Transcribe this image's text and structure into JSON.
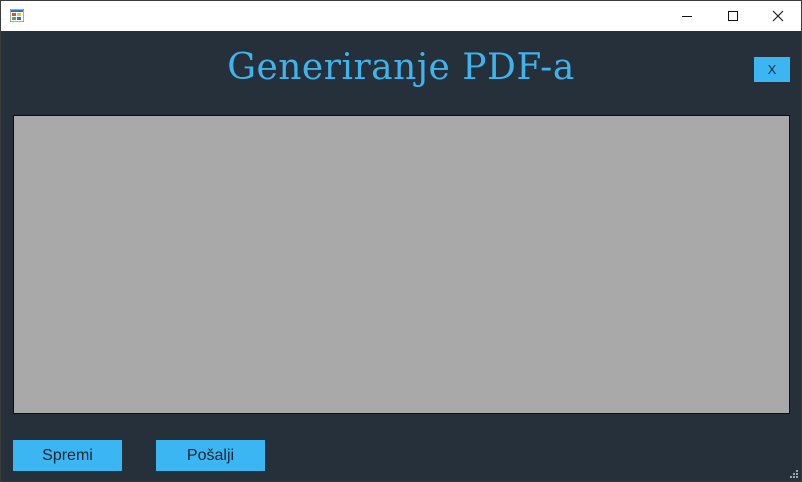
{
  "window": {
    "app_icon": "winforms-app-icon",
    "controls": {
      "minimize_icon": "minimize-icon",
      "maximize_icon": "maximize-icon",
      "close_icon": "close-icon"
    }
  },
  "form": {
    "title": "Generiranje PDF-a",
    "close_button_label": "X",
    "viewer_placeholder": "",
    "buttons": {
      "save_label": "Spremi",
      "send_label": "Pošalji"
    }
  },
  "colors": {
    "background": "#25303a",
    "accent": "#3cb6f3",
    "title_text": "#3fb3ec",
    "viewer_background": "#a9a9a9"
  }
}
